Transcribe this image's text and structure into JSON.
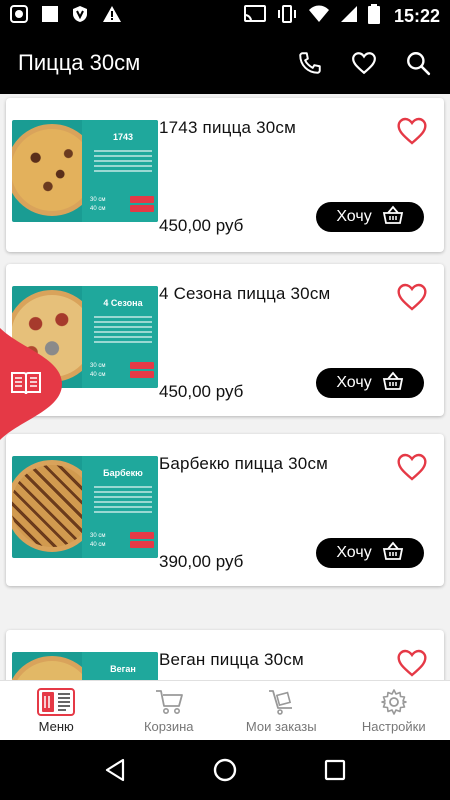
{
  "status_bar": {
    "time": "15:22"
  },
  "app_bar": {
    "title": "Пицца 30см"
  },
  "products": [
    {
      "name": "1743 пицца 30см",
      "price": "450,00 руб",
      "button": "Хочу",
      "banner": "1743",
      "sizes": [
        "30 см",
        "40 см"
      ]
    },
    {
      "name": "4 Сезона пицца 30см",
      "price": "450,00 руб",
      "button": "Хочу",
      "banner": "4 Сезона",
      "sizes": [
        "30 см",
        "40 см"
      ]
    },
    {
      "name": "Барбекю пицца 30см",
      "price": "390,00 руб",
      "button": "Хочу",
      "banner": "Барбекю",
      "sizes": [
        "30 см",
        "40 см"
      ]
    },
    {
      "name": "Веган пицца 30см",
      "banner": "Веган"
    }
  ],
  "bottom_nav": [
    {
      "label": "Меню",
      "icon": "menu-book-icon"
    },
    {
      "label": "Корзина",
      "icon": "cart-icon"
    },
    {
      "label": "Мои заказы",
      "icon": "orders-icon"
    },
    {
      "label": "Настройки",
      "icon": "gear-icon"
    }
  ],
  "colors": {
    "accent": "#e53946",
    "teal": "#1fa89c",
    "bar": "#000000"
  }
}
